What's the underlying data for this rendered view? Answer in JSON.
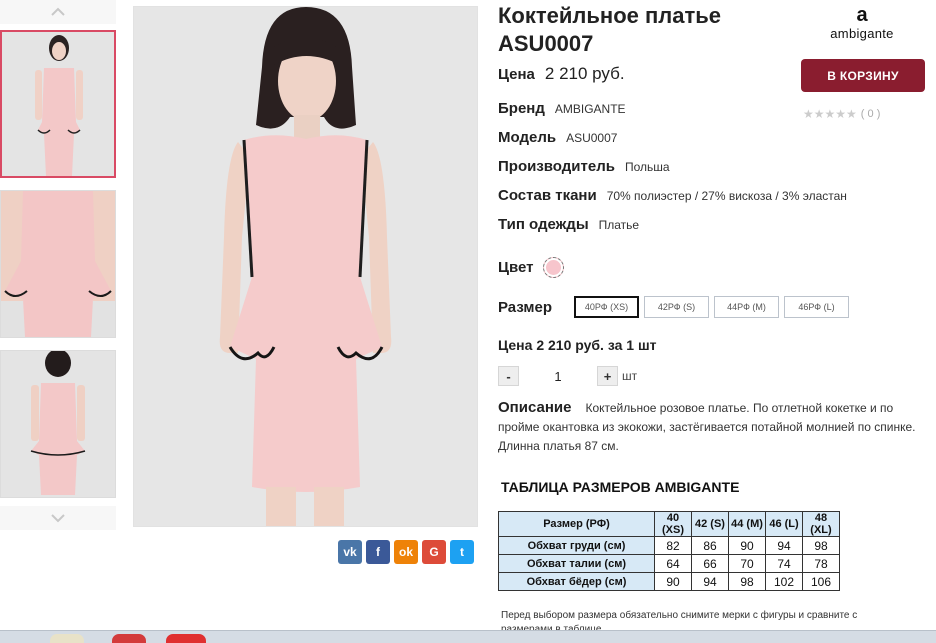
{
  "product": {
    "title": "Коктейльное платье ASU0007",
    "price_label": "Цена",
    "price_value": "2 210 руб.",
    "cart_button": "В КОРЗИНУ",
    "rating_count": "( 0 )",
    "brand_logo_mark": "a",
    "brand_logo_text": "ambigante"
  },
  "specs": [
    {
      "label": "Бренд",
      "value": "AMBIGANTE"
    },
    {
      "label": "Модель",
      "value": "ASU0007"
    },
    {
      "label": "Производитель",
      "value": "Польша"
    },
    {
      "label": "Состав ткани",
      "value": "70% полиэстер / 27% вискоза / 3% эластан"
    },
    {
      "label": "Тип одежды",
      "value": "Платье"
    }
  ],
  "color": {
    "label": "Цвет",
    "swatch": "#f7c5cc"
  },
  "size": {
    "label": "Размер",
    "options": [
      "40РФ (XS)",
      "42РФ (S)",
      "44РФ (M)",
      "46РФ (L)"
    ],
    "selected": "40РФ (XS)"
  },
  "quantity": {
    "price_line": "Цена 2 210 руб. за 1 шт",
    "minus": "-",
    "value": "1",
    "plus": "+",
    "unit": "шт"
  },
  "description": {
    "label": "Описание",
    "text": "Коктейльное розовое платье. По отлетной кокетке и по пройме окантовка из экокожи, застёгивается потайной молнией по спинке. Длинна платья 87 см."
  },
  "size_table": {
    "title": "ТАБЛИЦА РАЗМЕРОВ AMBIGANTE",
    "headers": [
      "Размер (РФ)",
      "40 (XS)",
      "42 (S)",
      "44 (M)",
      "46 (L)",
      "48 (XL)"
    ],
    "rows": [
      {
        "name": "Обхват груди (см)",
        "values": [
          "82",
          "86",
          "90",
          "94",
          "98"
        ]
      },
      {
        "name": "Обхват талии (см)",
        "values": [
          "64",
          "66",
          "70",
          "74",
          "78"
        ]
      },
      {
        "name": "Обхват бёдер (см)",
        "values": [
          "90",
          "94",
          "98",
          "102",
          "106"
        ]
      }
    ]
  },
  "note": "Перед выбором размера обязательно снимите мерки с фигуры и сравните с размерами в таблице.",
  "share": [
    {
      "label": "vk",
      "color": "#4a76a8"
    },
    {
      "label": "f",
      "color": "#3b5998"
    },
    {
      "label": "ok",
      "color": "#ee8208"
    },
    {
      "label": "G",
      "color": "#dd4b39"
    },
    {
      "label": "t",
      "color": "#1da1f2"
    }
  ],
  "colors": {
    "accent": "#d94a64",
    "cart": "#8a1d2f",
    "table_header": "#d7e9f6"
  }
}
